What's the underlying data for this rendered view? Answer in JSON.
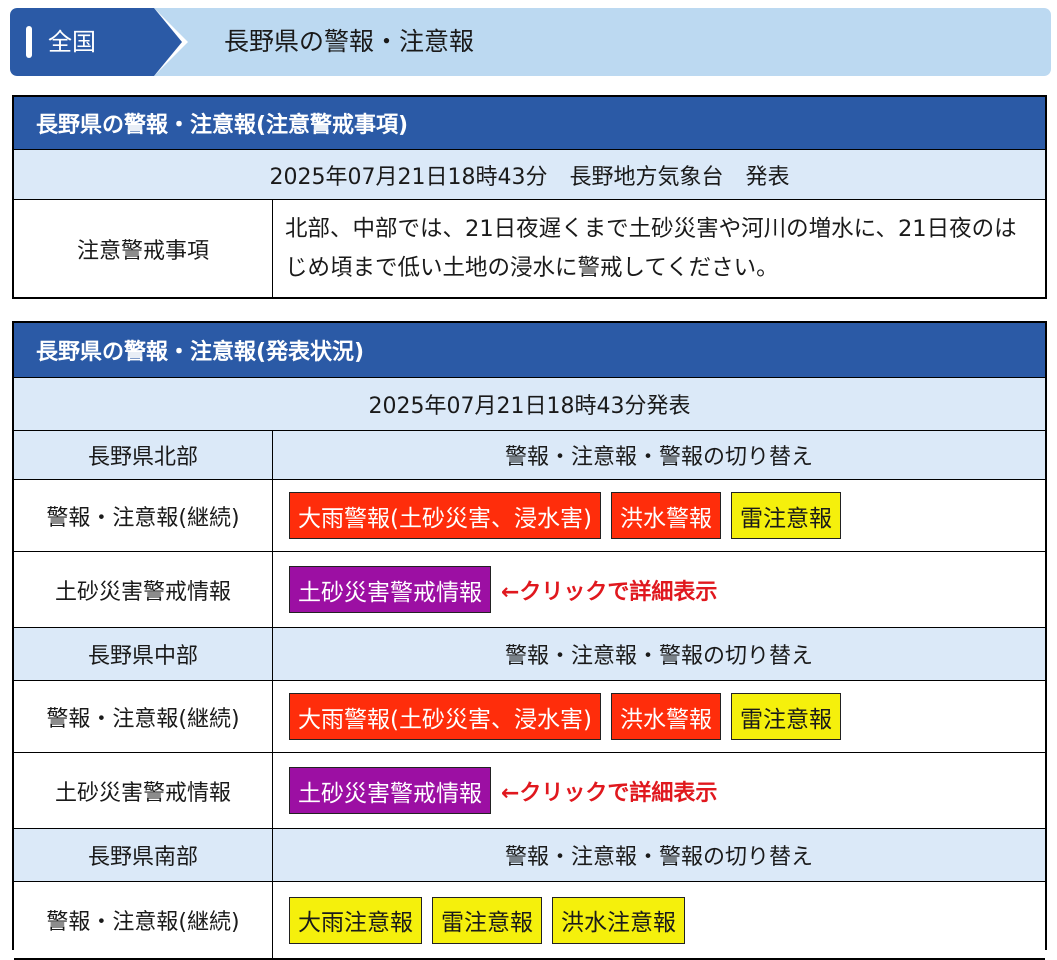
{
  "breadcrumb": {
    "home_label": "全国",
    "current_label": "長野県の警報・注意報"
  },
  "notice_table": {
    "title": "長野県の警報・注意報(注意警戒事項)",
    "issued": "2025年07月21日18時43分　長野地方気象台　発表",
    "row_label": "注意警戒事項",
    "row_text": "北部、中部では、21日夜遅くまで土砂災害や河川の増水に、21日夜のはじめ頃まで低い土地の浸水に警戒してください。"
  },
  "status_table": {
    "title": "長野県の警報・注意報(発表状況)",
    "issued": "2025年07月21日18時43分発表",
    "toggle_label": "警報・注意報・警報の切り替え",
    "areas": [
      {
        "name": "長野県北部",
        "warning_row_label": "警報・注意報(継続)",
        "badges": [
          {
            "label": "大雨警報(土砂災害、浸水害)",
            "kind": "warning"
          },
          {
            "label": "洪水警報",
            "kind": "warning"
          },
          {
            "label": "雷注意報",
            "kind": "advisory"
          }
        ],
        "sediment_row_label": "土砂災害警戒情報",
        "sediment_badge": "土砂災害警戒情報",
        "click_hint": "←クリックで詳細表示"
      },
      {
        "name": "長野県中部",
        "warning_row_label": "警報・注意報(継続)",
        "badges": [
          {
            "label": "大雨警報(土砂災害、浸水害)",
            "kind": "warning"
          },
          {
            "label": "洪水警報",
            "kind": "warning"
          },
          {
            "label": "雷注意報",
            "kind": "advisory"
          }
        ],
        "sediment_row_label": "土砂災害警戒情報",
        "sediment_badge": "土砂災害警戒情報",
        "click_hint": "←クリックで詳細表示"
      },
      {
        "name": "長野県南部",
        "warning_row_label": "警報・注意報(継続)",
        "badges": [
          {
            "label": "大雨注意報",
            "kind": "advisory"
          },
          {
            "label": "雷注意報",
            "kind": "advisory"
          },
          {
            "label": "洪水注意報",
            "kind": "advisory"
          }
        ]
      }
    ]
  },
  "colors": {
    "header_blue": "#2b5aa6",
    "light_blue": "#dbe9f8",
    "warning_red": "#ff2d0b",
    "advisory_yellow": "#f5f00c",
    "sediment_purple": "#9c0fa3",
    "hint_red": "#e0181e"
  }
}
